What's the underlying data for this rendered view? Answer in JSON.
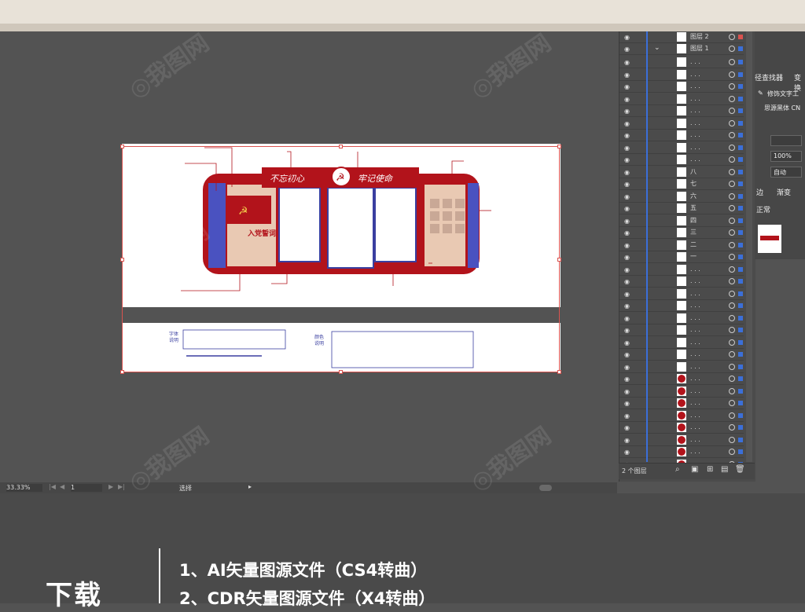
{
  "layers_panel": {
    "top_layer_name": "图层 2",
    "main_layer_name": "图层 1",
    "footer_label": "2 个图层",
    "sublayer_labels": [
      "八",
      "七",
      "六",
      "五",
      "四",
      "三",
      "二",
      "一"
    ],
    "placeholder_label": ". . ."
  },
  "properties_panel": {
    "path_finder_tab": "径查找器",
    "transform_tab": "变换",
    "tool_label": "修饰文字工",
    "font_name": "思源黑体 CN",
    "zoom_value": "100%",
    "auto_value": "自动",
    "stroke_tab": "边",
    "gradient_tab": "渐变",
    "blend_mode": "正常"
  },
  "status_bar": {
    "zoom": "33.33%",
    "artboard_number": "1",
    "tool_name": "选择"
  },
  "artwork": {
    "slogan_left": "不忘初心",
    "slogan_right": "牢记使命",
    "section_join_party": "入党誓词"
  },
  "notes": {
    "left_label_1": "字体",
    "left_label_2": "说明",
    "right_label_1": "颜色",
    "right_label_2": "说明"
  },
  "download": {
    "title": "下载",
    "line1": "1、AI矢量图源文件（CS4转曲）",
    "line2": "2、CDR矢量图源文件（X4转曲）"
  },
  "colors": {
    "party_red": "#b2131b",
    "panel_blue": "#3a3fa0",
    "beige": "#e9c9b3",
    "selection_red": "#d9534f",
    "layer_blue": "#3b6fd8"
  }
}
